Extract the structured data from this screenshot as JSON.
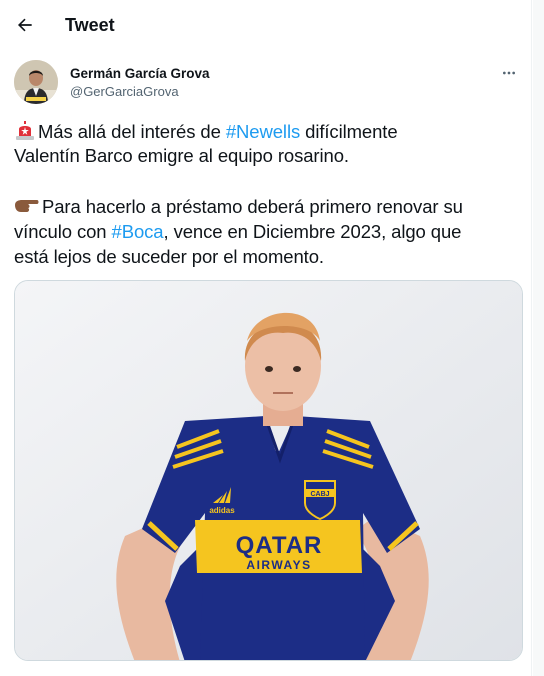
{
  "header": {
    "title": "Tweet"
  },
  "author": {
    "name": "Germán García Grova",
    "handle": "@GerGarciaGrova"
  },
  "tweet": {
    "line1": {
      "pre": "Más allá del interés de ",
      "hashtag": "#Newells",
      "post": " difícilmente"
    },
    "line2": "Valentín Barco emigre al equipo rosarino.",
    "para2_line1": "Para hacerlo a préstamo deberá primero renovar su",
    "para2_line2": {
      "pre": "vínculo con ",
      "hashtag": "#Boca",
      "post": ", vence en Diciembre 2023, algo que"
    },
    "para2_line3": "está lejos de suceder por el momento."
  },
  "media": {
    "jersey_brand": "adidas",
    "crest_text": "CABJ",
    "sponsor_line1": "QATAR",
    "sponsor_line2": "AIRWAYS"
  },
  "icons": {
    "back": "arrow-left-icon",
    "more": "more-horizontal-icon",
    "emoji1": "rotating-light-emoji",
    "emoji2": "backhand-index-pointing-right-emoji"
  },
  "colors": {
    "link": "#1d9bf0",
    "text": "#0f1419",
    "secondary": "#536471",
    "jersey_blue": "#1c2d86",
    "jersey_yellow": "#f5c51f"
  }
}
